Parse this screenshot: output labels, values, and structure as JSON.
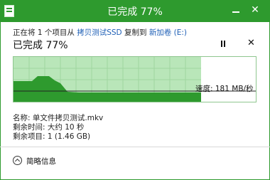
{
  "window": {
    "title": "已完成 77%",
    "accent_color": "#2e9a2e"
  },
  "dialog": {
    "desc_prefix": "正在将 1 个项目从 ",
    "source": "拷贝测试SSD",
    "desc_middle": " 复制到 ",
    "destination": "新加卷 (E:)",
    "percent_label": "已完成 77%",
    "pause_icon": "pause-icon",
    "close_icon": "close-icon",
    "speed": "速度: 181 MB/秒",
    "progress": 0.77,
    "info": {
      "name": "名称: 单文件拷贝测试.mkv",
      "time_left": "剩余时间: 大约 10 秒",
      "items_left": "剩余项目: 1 (1.46 GB)"
    },
    "fewer_details": "简略信息"
  }
}
